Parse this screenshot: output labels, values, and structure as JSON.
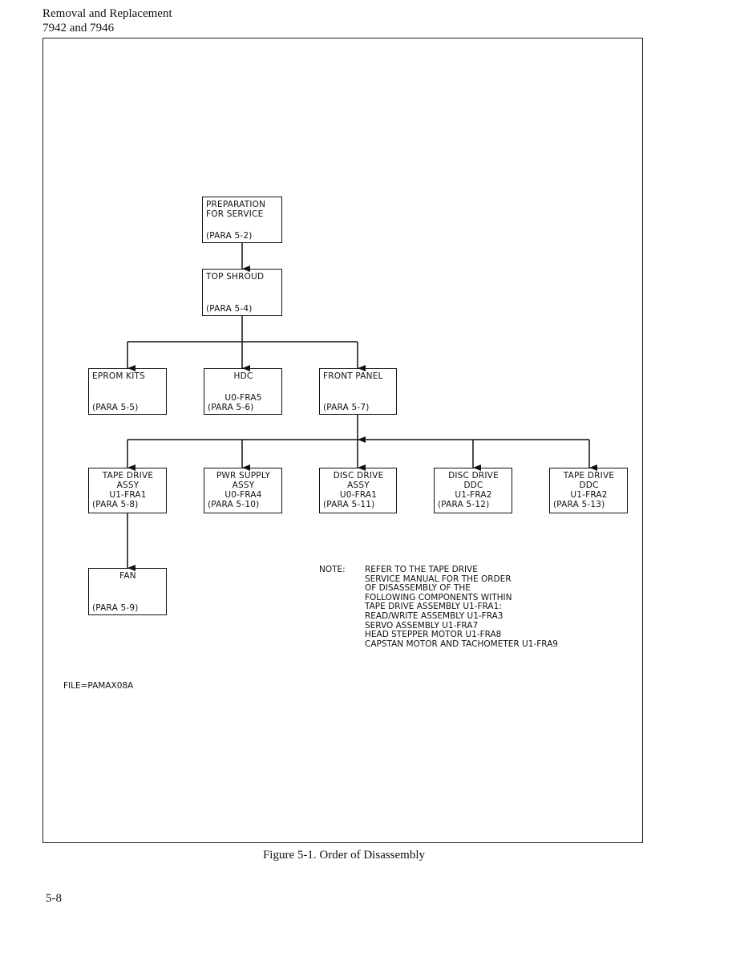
{
  "header": {
    "line1": "Removal and Replacement",
    "line2": "7942 and 7946"
  },
  "diagram": {
    "boxes": {
      "prep": [
        "PREPARATION",
        "FOR SERVICE",
        "(PARA 5-2)"
      ],
      "top_shroud": [
        "TOP SHROUD",
        "(PARA 5-4)"
      ],
      "eprom": [
        "EPROM KITS",
        "(PARA 5-5)"
      ],
      "hdc": [
        "HDC",
        "U0-FRA5",
        "(PARA 5-6)"
      ],
      "front_panel": [
        "FRONT PANEL",
        "(PARA 5-7)"
      ],
      "tape_drive_assy": [
        "TAPE DRIVE",
        "ASSY",
        "U1-FRA1",
        "(PARA 5-8)"
      ],
      "pwr_supply": [
        "PWR SUPPLY",
        "ASSY",
        "U0-FRA4",
        "(PARA 5-10)"
      ],
      "disc_drive_assy": [
        "DISC DRIVE",
        "ASSY",
        "U0-FRA1",
        "(PARA 5-11)"
      ],
      "disc_drive_ddc": [
        "DISC DRIVE",
        "DDC",
        "U1-FRA2",
        "(PARA 5-12)"
      ],
      "tape_drive_ddc": [
        "TAPE DRIVE",
        "DDC",
        "U1-FRA2",
        "(PARA 5-13)"
      ],
      "fan": [
        "FAN",
        "(PARA 5-9)"
      ]
    },
    "note": {
      "label": "NOTE:",
      "lines": [
        "REFER TO THE TAPE DRIVE",
        "SERVICE MANUAL FOR THE ORDER",
        "OF DISASSEMBLY OF THE",
        "FOLLOWING COMPONENTS WITHIN",
        "TAPE DRIVE ASSEMBLY U1-FRA1:",
        "READ/WRITE ASSEMBLY U1-FRA3",
        "SERVO ASSEMBLY U1-FRA7",
        "HEAD STEPPER MOTOR U1-FRA8",
        "CAPSTAN MOTOR AND TACHOMETER U1-FRA9"
      ]
    },
    "file": "FILE=PAMAX08A"
  },
  "caption": "Figure 5-1. Order of Disassembly",
  "page_number": "5-8"
}
